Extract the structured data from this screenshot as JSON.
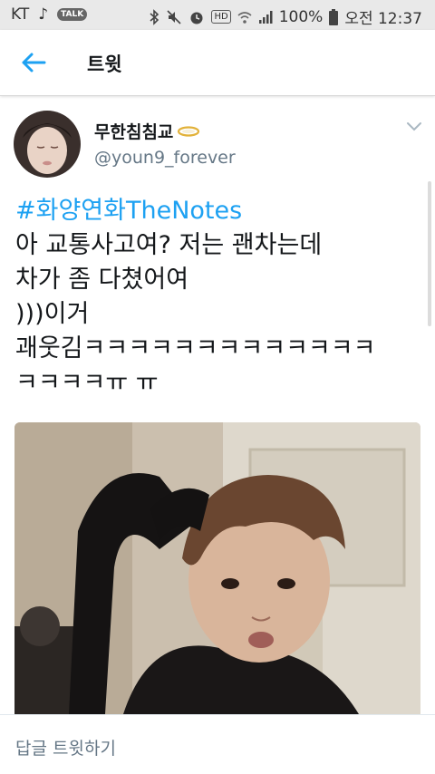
{
  "status_bar": {
    "carrier": "KT",
    "talk_badge": "TALK",
    "hd_badge": "HD",
    "battery": "100%",
    "time": "오전 12:37"
  },
  "header": {
    "title": "트윗"
  },
  "tweet": {
    "display_name": "무한침침교",
    "handle": "@youn9_forever",
    "hashtag": "#화양연화TheNotes",
    "lines": [
      "아 교통사고여? 저는 괜차는데",
      "차가 좀 다쳤어여",
      ")))이거",
      "괘웃김ㅋㅋㅋㅋㅋㅋㅋㅋㅋㅋㅋㅋㅋ",
      "ㅋㅋㅋㅋㅠ ㅠ"
    ]
  },
  "reply_bar": {
    "placeholder": "답글 트윗하기"
  },
  "colors": {
    "accent": "#1da1f2",
    "text": "#14171a",
    "secondary": "#657786"
  }
}
